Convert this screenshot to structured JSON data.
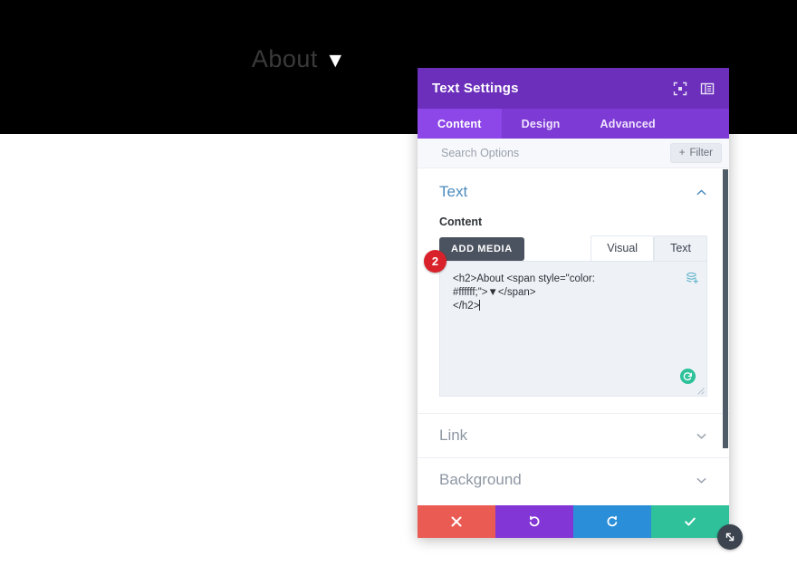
{
  "page": {
    "hero_title": "About",
    "hero_caret": "▼",
    "hero_bg_color": "#000000",
    "hero_title_color": "#3a3a3a"
  },
  "modal": {
    "title": "Text Settings",
    "header_color": "#6b2fbc",
    "header_icons": [
      {
        "name": "fullscreen-icon",
        "label": "Fullscreen"
      },
      {
        "name": "layout-panel-icon",
        "label": "Change panel layout"
      }
    ],
    "tabs": [
      {
        "label": "Content",
        "active": true
      },
      {
        "label": "Design",
        "active": false
      },
      {
        "label": "Advanced",
        "active": false
      }
    ],
    "search": {
      "placeholder": "Search Options",
      "value": ""
    },
    "filter_button": {
      "label": "Filter",
      "plus": "+"
    },
    "sections": [
      {
        "title": "Text",
        "state": "open",
        "chevron": "up",
        "title_color": "#4b8bbe"
      },
      {
        "title": "Link",
        "state": "closed",
        "chevron": "down",
        "title_color": "#8e97a3"
      },
      {
        "title": "Background",
        "state": "closed",
        "chevron": "down",
        "title_color": "#8e97a3"
      }
    ],
    "content_field": {
      "label": "Content",
      "add_media_label": "ADD MEDIA",
      "editor_tabs": [
        {
          "label": "Visual",
          "active": false
        },
        {
          "label": "Text",
          "active": true
        }
      ],
      "editor_value_line1": "<h2>About <span style=\"color: #ffffff;\">▼</span>",
      "editor_value_line2": "</h2>",
      "badge": "2",
      "badge_color": "#d8212a",
      "layer_icon_name": "add-layer-icon",
      "reload_icon_name": "reload-icon",
      "reload_icon_color": "#2ec19a"
    },
    "footer_buttons": [
      {
        "name": "cancel-button",
        "icon": "close-icon",
        "color": "#ea5b54"
      },
      {
        "name": "undo-button",
        "icon": "undo-icon",
        "color": "#8236d6"
      },
      {
        "name": "redo-button",
        "icon": "redo-icon",
        "color": "#2a8fd8"
      },
      {
        "name": "save-button",
        "icon": "check-icon",
        "color": "#2ec19a"
      }
    ],
    "resize_handle": {
      "name": "modal-resize-handle",
      "icon": "diagonal-resize-icon"
    }
  }
}
